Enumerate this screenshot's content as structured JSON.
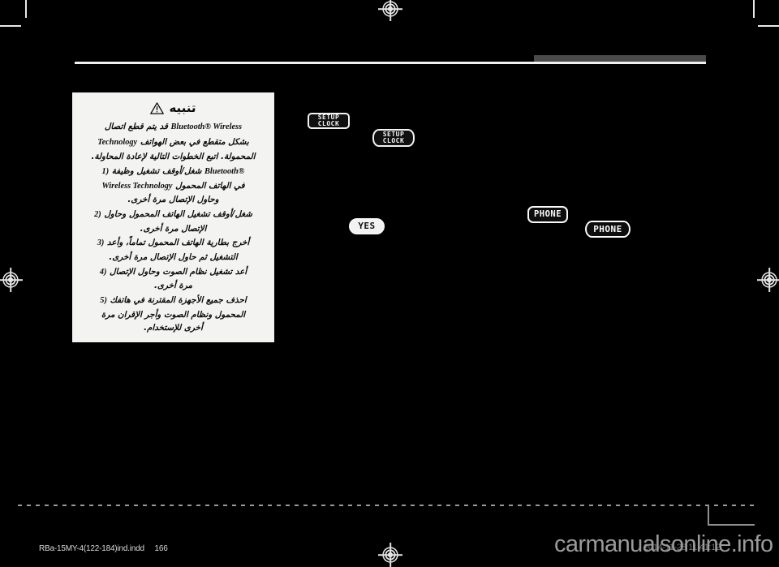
{
  "document": {
    "caution_box": {
      "title": "تنبيه",
      "warning_icon": "warning-triangle-icon",
      "lead_paragraph": {
        "segments": [
          {
            "type": "ar",
            "text": "قد يتم قطع اتصال"
          },
          {
            "type": "lat",
            "text": "Bluetooth® Wireless"
          },
          {
            "type": "ar",
            "text": "بشكل متقطع في بعض الهواتف"
          },
          {
            "type": "lat",
            "text": "Technology"
          },
          {
            "type": "ar",
            "text": "المحمولة. اتبع الخطوات التالية لإعادة المحاولة."
          }
        ],
        "line1_ar": "قد يتم قطع اتصال",
        "line1_lat": "Bluetooth® Wireless",
        "line2_lat": "Technology",
        "line2_ar": "بشكل متقطع في بعض الهواتف",
        "line3_ar": "المحمولة. اتبع الخطوات التالية لإعادة المحاولة."
      },
      "steps": [
        {
          "number": "1)",
          "line1_ar": "شغل/أوقف تشغيل وظيفة",
          "line1_lat": "Bluetooth®",
          "line2_lat": "Wireless Technology",
          "line2_ar": "في الهاتف المحمول",
          "line3_ar": "وحاول الإتصال مرة أخرى."
        },
        {
          "number": "2)",
          "line1_ar": "شغل/أوقف تشغيل الهاتف المحمول وحاول",
          "line2_ar": "الإتصال مرة أخرى."
        },
        {
          "number": "3)",
          "line1_ar": "أخرج بطارية الهاتف المحمول تماماً، وأعد",
          "line2_ar": "التشغيل ثم حاول الإتصال مرة أخرى."
        },
        {
          "number": "4)",
          "line1_ar": "أعد تشغيل نظام الصوت وحاول الإتصال",
          "line2_ar": "مرة أخرى."
        },
        {
          "number": "5)",
          "line1_ar": "احذف جميع الأجهزة المقترنة في هاتفك",
          "line2_ar": "المحمول ونظام الصوت وأجر الإقران مرة",
          "line3_ar": "أخرى للإستخدام."
        }
      ]
    },
    "control_keys": [
      {
        "id": "setup-clock-1",
        "label": "SETUP\nCLOCK",
        "style": "outline-light"
      },
      {
        "id": "setup-clock-2",
        "label": "SETUP\nCLOCK",
        "style": "outline-light"
      },
      {
        "id": "yes",
        "label": "YES",
        "style": "solid-light"
      },
      {
        "id": "phone-1",
        "label": "PHONE",
        "style": "inverted"
      },
      {
        "id": "phone-2",
        "label": "PHONE",
        "style": "inverted"
      }
    ],
    "footer": {
      "file_name": "RBa-15MY-4(122-184)ind.indd",
      "page_number": "166",
      "date_stamp": "2014-11-28   11:41:12",
      "watermark": "carmanualsonline.info"
    },
    "colors": {
      "page_background": "#000000",
      "caution_box_background": "#f3f3f1",
      "rule": "#f0f0f0",
      "header_tab": "#4a4a4a",
      "watermark": "#9b9b9b"
    }
  }
}
